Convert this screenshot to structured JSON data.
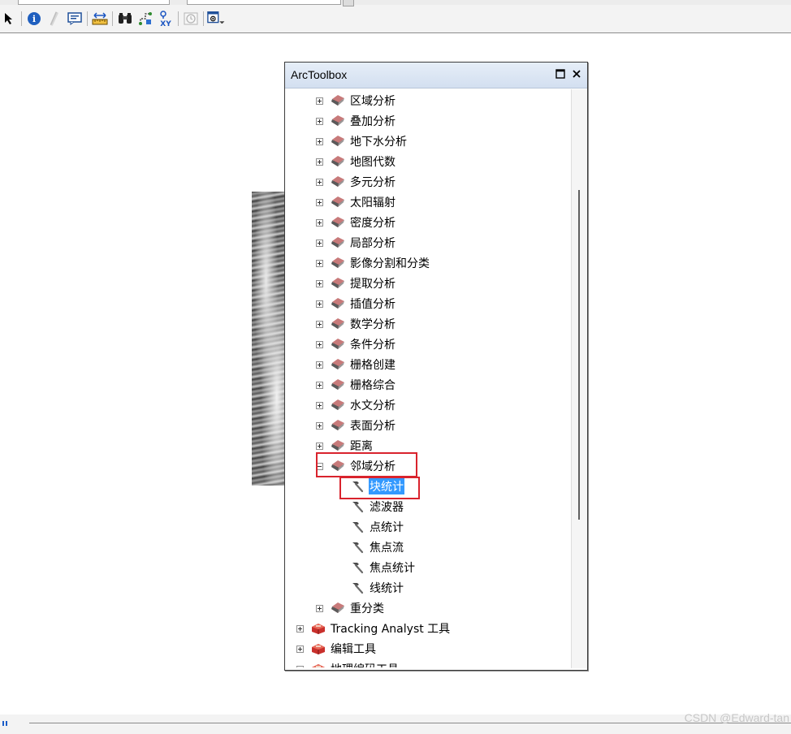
{
  "toolbar": {
    "tools": [
      {
        "icon": "select-arrow-icon"
      },
      {
        "icon": "identify-icon"
      },
      {
        "icon": "hyperlink-icon"
      },
      {
        "icon": "html-popup-icon"
      },
      {
        "icon": "measure-icon"
      },
      {
        "icon": "find-icon"
      },
      {
        "icon": "find-route-icon"
      },
      {
        "icon": "go-to-xy-icon"
      },
      {
        "icon": "time-slider-icon"
      },
      {
        "icon": "magnifier-window-icon"
      }
    ]
  },
  "arctoolbox": {
    "title": "ArcToolbox",
    "tree": [
      {
        "label": "区域分析",
        "kind": "toolset",
        "level": 1,
        "expander": "plus"
      },
      {
        "label": "叠加分析",
        "kind": "toolset",
        "level": 1,
        "expander": "plus"
      },
      {
        "label": "地下水分析",
        "kind": "toolset",
        "level": 1,
        "expander": "plus"
      },
      {
        "label": "地图代数",
        "kind": "toolset",
        "level": 1,
        "expander": "plus"
      },
      {
        "label": "多元分析",
        "kind": "toolset",
        "level": 1,
        "expander": "plus"
      },
      {
        "label": "太阳辐射",
        "kind": "toolset",
        "level": 1,
        "expander": "plus"
      },
      {
        "label": "密度分析",
        "kind": "toolset",
        "level": 1,
        "expander": "plus"
      },
      {
        "label": "局部分析",
        "kind": "toolset",
        "level": 1,
        "expander": "plus"
      },
      {
        "label": "影像分割和分类",
        "kind": "toolset",
        "level": 1,
        "expander": "plus"
      },
      {
        "label": "提取分析",
        "kind": "toolset",
        "level": 1,
        "expander": "plus"
      },
      {
        "label": "插值分析",
        "kind": "toolset",
        "level": 1,
        "expander": "plus"
      },
      {
        "label": "数学分析",
        "kind": "toolset",
        "level": 1,
        "expander": "plus"
      },
      {
        "label": "条件分析",
        "kind": "toolset",
        "level": 1,
        "expander": "plus"
      },
      {
        "label": "栅格创建",
        "kind": "toolset",
        "level": 1,
        "expander": "plus"
      },
      {
        "label": "栅格综合",
        "kind": "toolset",
        "level": 1,
        "expander": "plus"
      },
      {
        "label": "水文分析",
        "kind": "toolset",
        "level": 1,
        "expander": "plus"
      },
      {
        "label": "表面分析",
        "kind": "toolset",
        "level": 1,
        "expander": "plus"
      },
      {
        "label": "距离",
        "kind": "toolset",
        "level": 1,
        "expander": "plus"
      },
      {
        "label": "邻域分析",
        "kind": "toolset",
        "level": 1,
        "expander": "minus"
      },
      {
        "label": "块统计",
        "kind": "tool",
        "level": 2,
        "selected": true
      },
      {
        "label": "滤波器",
        "kind": "tool",
        "level": 2
      },
      {
        "label": "点统计",
        "kind": "tool",
        "level": 2
      },
      {
        "label": "焦点流",
        "kind": "tool",
        "level": 2
      },
      {
        "label": "焦点统计",
        "kind": "tool",
        "level": 2
      },
      {
        "label": "线统计",
        "kind": "tool",
        "level": 2
      },
      {
        "label": "重分类",
        "kind": "toolset",
        "level": 1,
        "expander": "plus"
      },
      {
        "label": "Tracking Analyst 工具",
        "kind": "toolbox",
        "level": 0,
        "expander": "plus"
      },
      {
        "label": "编辑工具",
        "kind": "toolbox",
        "level": 0,
        "expander": "plus"
      },
      {
        "label": "地理编码工具",
        "kind": "toolbox",
        "level": 0,
        "expander": "plus"
      }
    ]
  },
  "watermark": "CSDN @Edward-tan"
}
